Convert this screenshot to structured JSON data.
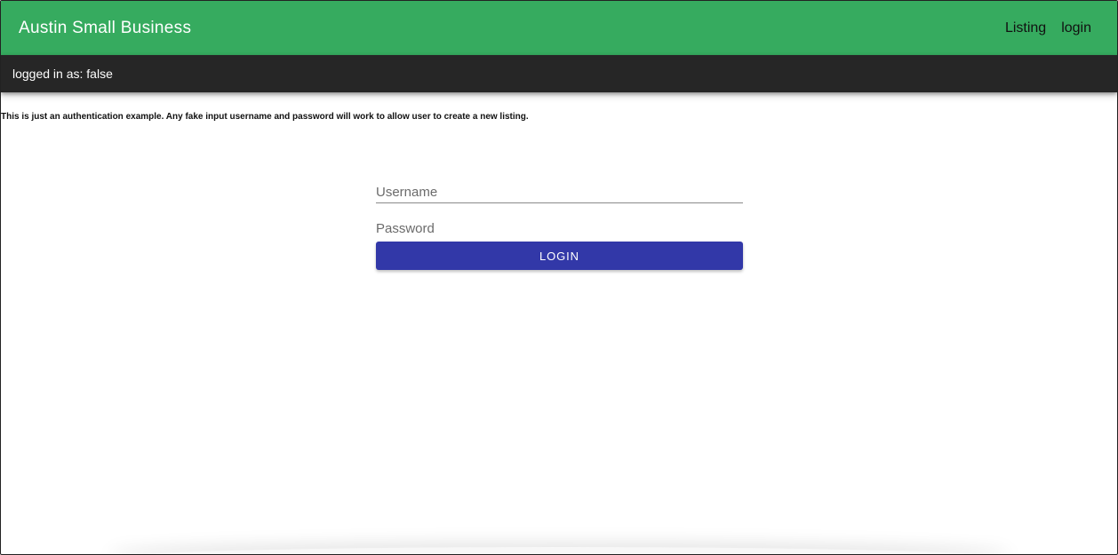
{
  "app_bar": {
    "title": "Austin Small Business",
    "nav": [
      {
        "label": "Listing"
      },
      {
        "label": "login"
      }
    ],
    "color": "#36ab5f"
  },
  "status_bar": {
    "text": "logged in as: false",
    "color": "#262626"
  },
  "notice": {
    "text": "This is just an authentication example. Any fake input username and password will work to allow user to create a new listing."
  },
  "login_form": {
    "username": {
      "placeholder": "Username",
      "value": ""
    },
    "password": {
      "placeholder": "Password",
      "value": ""
    },
    "submit_label": "LOGIN",
    "button_color": "#3238a8"
  }
}
